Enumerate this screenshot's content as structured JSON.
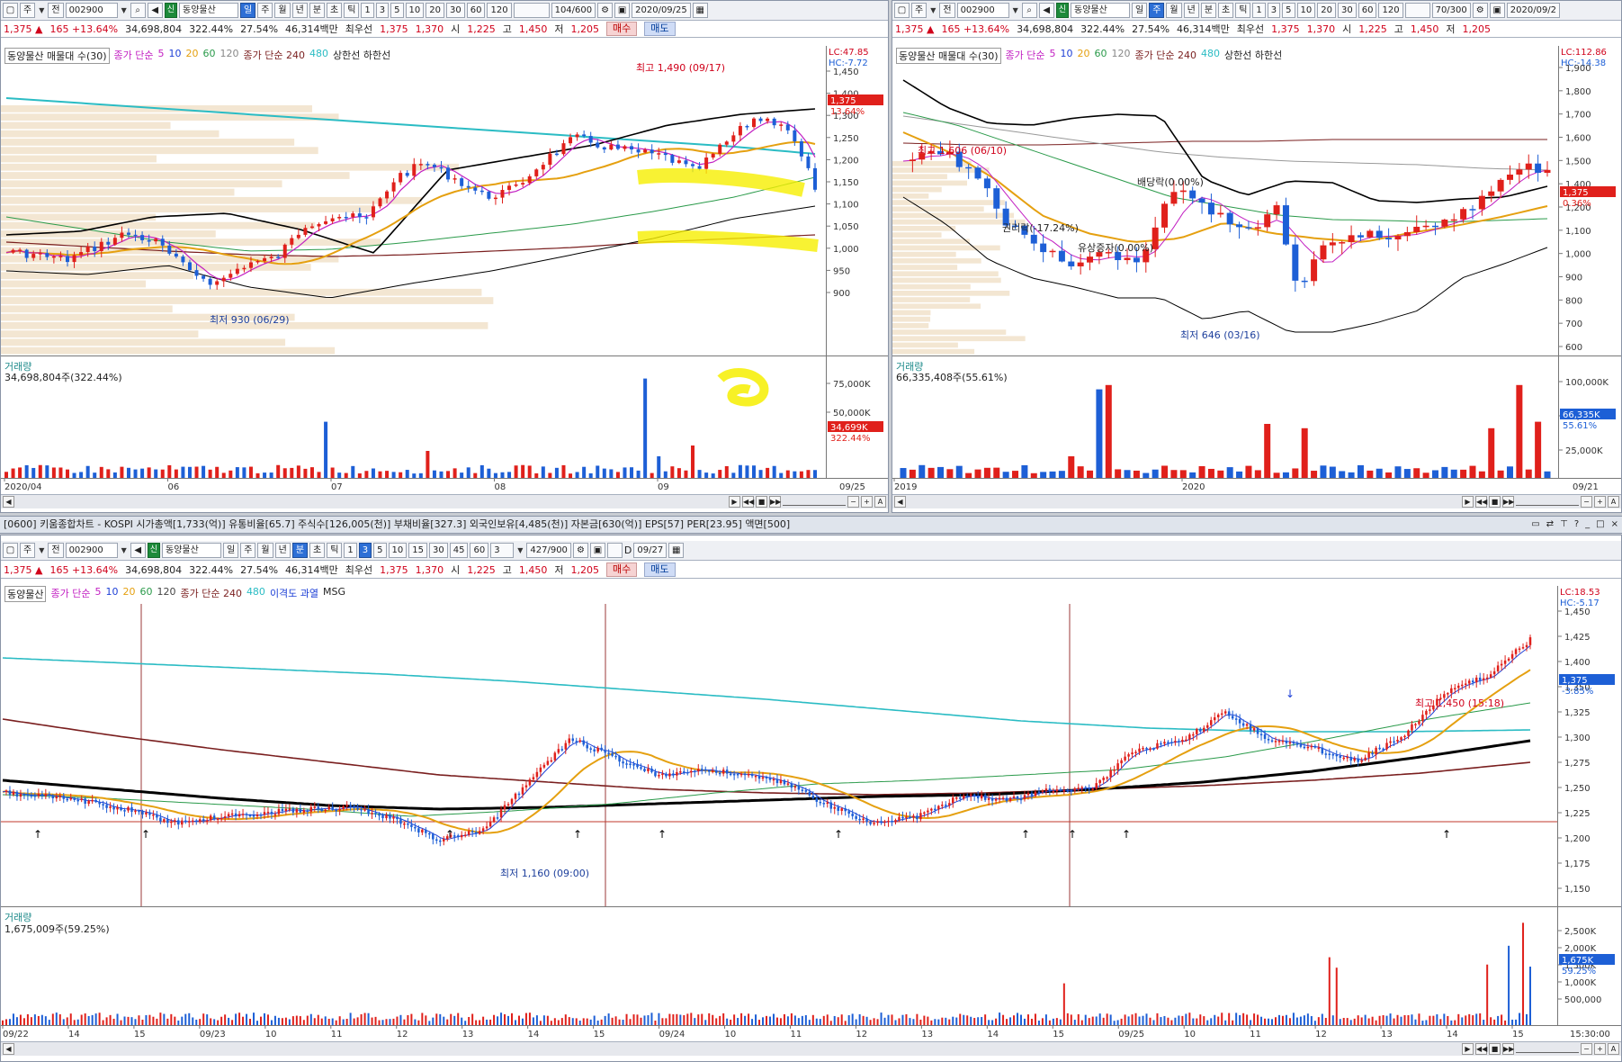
{
  "stock": {
    "code": "002900",
    "name": "동양물산",
    "badge": "신",
    "price": "1,375",
    "change_arrow": "▲",
    "change": "165",
    "change_pct": "+13.64%",
    "volume": "34,698,804",
    "volume_pct": "322.44%",
    "turnover_pct": "27.54%",
    "amount": "46,314백만",
    "best_ask_label": "최우선",
    "best_ask": "1,375",
    "best_bid": "1,370",
    "open_label": "시",
    "open": "1,225",
    "high_label": "고",
    "high": "1,450",
    "low_label": "저",
    "low": "1,205",
    "buy_label": "매수",
    "sell_label": "매도"
  },
  "toolbar": {
    "market_type": "주",
    "prefix": "전",
    "periods": [
      "일",
      "주",
      "월",
      "년",
      "분",
      "초",
      "틱"
    ],
    "intervals": [
      "1",
      "3",
      "5",
      "10",
      "20",
      "30",
      "60",
      "120"
    ]
  },
  "daily_chart": {
    "count": "104/600",
    "date": "2020/09/25",
    "legend": {
      "volume_profile": "동양물산 매물대 수(30)",
      "ma_label": "종가 단순",
      "ma_periods": [
        "5",
        "10",
        "20",
        "60",
        "120"
      ],
      "ma240_label": "종가 단순 240",
      "ma480": "480",
      "bands": "상한선 하한선"
    },
    "lc": "LC:47.85",
    "hc": "HC:-7.72",
    "price_ticks": [
      "1,450",
      "1,400",
      "1,300",
      "1,250",
      "1,200",
      "1,150",
      "1,100",
      "1,050",
      "1,000",
      "950",
      "900"
    ],
    "price_tag": "1,375",
    "price_tag_pct": "13.64%",
    "high_annotation": "최고 1,490 (09/17)",
    "low_annotation": "최저 930 (06/29)",
    "volume_title": "거래량",
    "volume_value": "34,698,804주(322.44%)",
    "volume_ticks": [
      "75,000K",
      "50,000K"
    ],
    "volume_tag": "34,699K",
    "volume_tag_pct": "322.44%",
    "time_labels": [
      "2020/04",
      "06",
      "07",
      "08",
      "09"
    ],
    "last_date": "09/25"
  },
  "weekly_chart": {
    "count": "70/300",
    "date": "2020/09/2",
    "legend": {
      "volume_profile": "동양물산 매물대 수(30)",
      "ma_label": "종가 단순",
      "ma_periods": [
        "5",
        "10",
        "20",
        "60",
        "120"
      ],
      "ma240_label": "종가 단순 240",
      "ma480": "480",
      "bands": "상한선 하한선"
    },
    "lc": "LC:112.86",
    "hc": "HC:-14.38",
    "price_ticks": [
      "1,900",
      "1,800",
      "1,700",
      "1,600",
      "1,500",
      "1,400",
      "1,200",
      "1,100",
      "1,000",
      "900",
      "800",
      "700",
      "600"
    ],
    "price_tag": "1,375",
    "price_tag_pct": "0.36%",
    "high_annotation": "최고 1,606 (06/10)",
    "dividend": "배당락(0.00%)",
    "rights": "권리락(-17.24%)",
    "capital": "유상증자(0.00%)",
    "low_annotation": "최저 646 (03/16)",
    "volume_title": "거래량",
    "volume_value": "66,335,408주(55.61%)",
    "volume_ticks": [
      "100,000K",
      "75,000K",
      "25,000K"
    ],
    "volume_tag": "66,335K",
    "volume_tag_pct": "55.61%",
    "time_labels": [
      "2019",
      "2020"
    ],
    "last_date": "09/21"
  },
  "window_title": "[0600] 키움종합차트 - KOSPI 시가총액[1,733(억)] 유통비율[65.7] 주식수[126,005(천)] 부채비율[327.3] 외국인보유[4,485(천)] 자본금[630(억)] EPS[57] PER[23.95] 액면[500]",
  "minute_chart": {
    "count": "427/900",
    "interval_value": "3",
    "date_checkbox": "D",
    "date": "09/27",
    "legend": {
      "name": "동양물산",
      "ma_label": "종가 단순",
      "ma_periods": [
        "5",
        "10",
        "20",
        "60",
        "120"
      ],
      "ma240_label": "종가 단순 240",
      "ma480": "480",
      "extra": "이격도 과열",
      "msg": "MSG"
    },
    "lc": "LC:18.53",
    "hc": "HC:-5.17",
    "price_ticks": [
      "1,450",
      "1,425",
      "1,400",
      "1,350",
      "1,325",
      "1,300",
      "1,275",
      "1,250",
      "1,225",
      "1,200",
      "1,175",
      "1,150"
    ],
    "price_tag": "1,375",
    "price_tag_pct": "-3.85%",
    "high_annotation": "최고 1,450 (15:18)",
    "low_annotation": "최저 1,160 (09:00)",
    "volume_title": "거래량",
    "volume_value": "1,675,009주(59.25%)",
    "volume_ticks": [
      "2,500K",
      "2,000K",
      "1,500K",
      "1,000K",
      "500,000"
    ],
    "volume_tag": "1,675K",
    "volume_tag_pct": "59.25%",
    "time_labels": [
      "09/22",
      "14",
      "15",
      "09/23",
      "10",
      "11",
      "12",
      "13",
      "14",
      "15",
      "09/24",
      "10",
      "11",
      "12",
      "13",
      "14",
      "15",
      "09/25",
      "10",
      "11",
      "12",
      "13",
      "14",
      "15"
    ],
    "last_time": "15:30:00"
  },
  "colors": {
    "up": "#e0201b",
    "down": "#1d5fd6",
    "ma5": "#c21fc2",
    "ma20": "#e5a010",
    "ma60": "#2a9a4a",
    "ma240": "#2bbcc4",
    "bands": "#000000",
    "highlight": "#f6ef00"
  }
}
